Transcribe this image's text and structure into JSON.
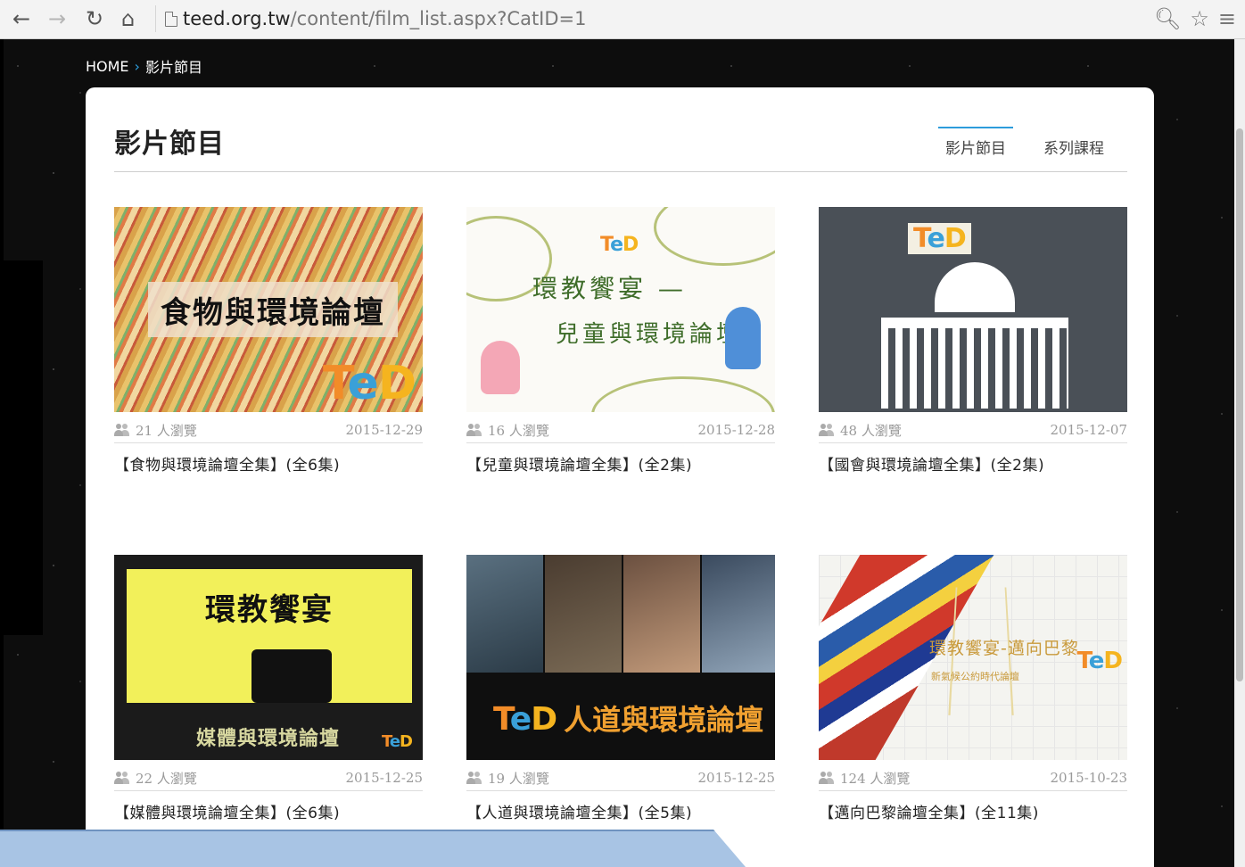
{
  "browser": {
    "url_host": "teed.org.tw",
    "url_path": "/content/film_list.aspx?CatID=1"
  },
  "breadcrumb": {
    "home": "HOME",
    "separator": "›",
    "current": "影片節目"
  },
  "panel": {
    "title": "影片節目",
    "tabs": [
      {
        "label": "影片節目",
        "active": true
      },
      {
        "label": "系列課程",
        "active": false
      }
    ]
  },
  "films": [
    {
      "views": "21 人瀏覽",
      "date": "2015-12-29",
      "title": "【食物與環境論壇全集】(全6集)",
      "thumb_text": "食物與環境論壇"
    },
    {
      "views": "16 人瀏覽",
      "date": "2015-12-28",
      "title": "【兒童與環境論壇全集】(全2集)",
      "thumb_text_1": "環教饗宴 —",
      "thumb_text_2": "兒童與環境論壇"
    },
    {
      "views": "48 人瀏覽",
      "date": "2015-12-07",
      "title": "【國會與環境論壇全集】(全2集)"
    },
    {
      "views": "22 人瀏覽",
      "date": "2015-12-25",
      "title": "【媒體與環境論壇全集】(全6集)",
      "thumb_text_1": "環教饗宴",
      "thumb_text_2": "媒體與環境論壇"
    },
    {
      "views": "19 人瀏覽",
      "date": "2015-12-25",
      "title": "【人道與環境論壇全集】(全5集)",
      "thumb_text": "人道與環境論壇"
    },
    {
      "views": "124 人瀏覽",
      "date": "2015-10-23",
      "title": "【邁向巴黎論壇全集】(全11集)",
      "thumb_text_1": "環教饗宴-邁向巴黎",
      "thumb_text_2": "新氣候公約時代論壇"
    }
  ],
  "logo": {
    "t": "T",
    "e": "e",
    "d": "D"
  },
  "colors": {
    "accent": "#2d9cdb",
    "ted_orange": "#f28c28",
    "ted_blue": "#3aa0d8",
    "ted_yellow": "#f5b41f"
  }
}
